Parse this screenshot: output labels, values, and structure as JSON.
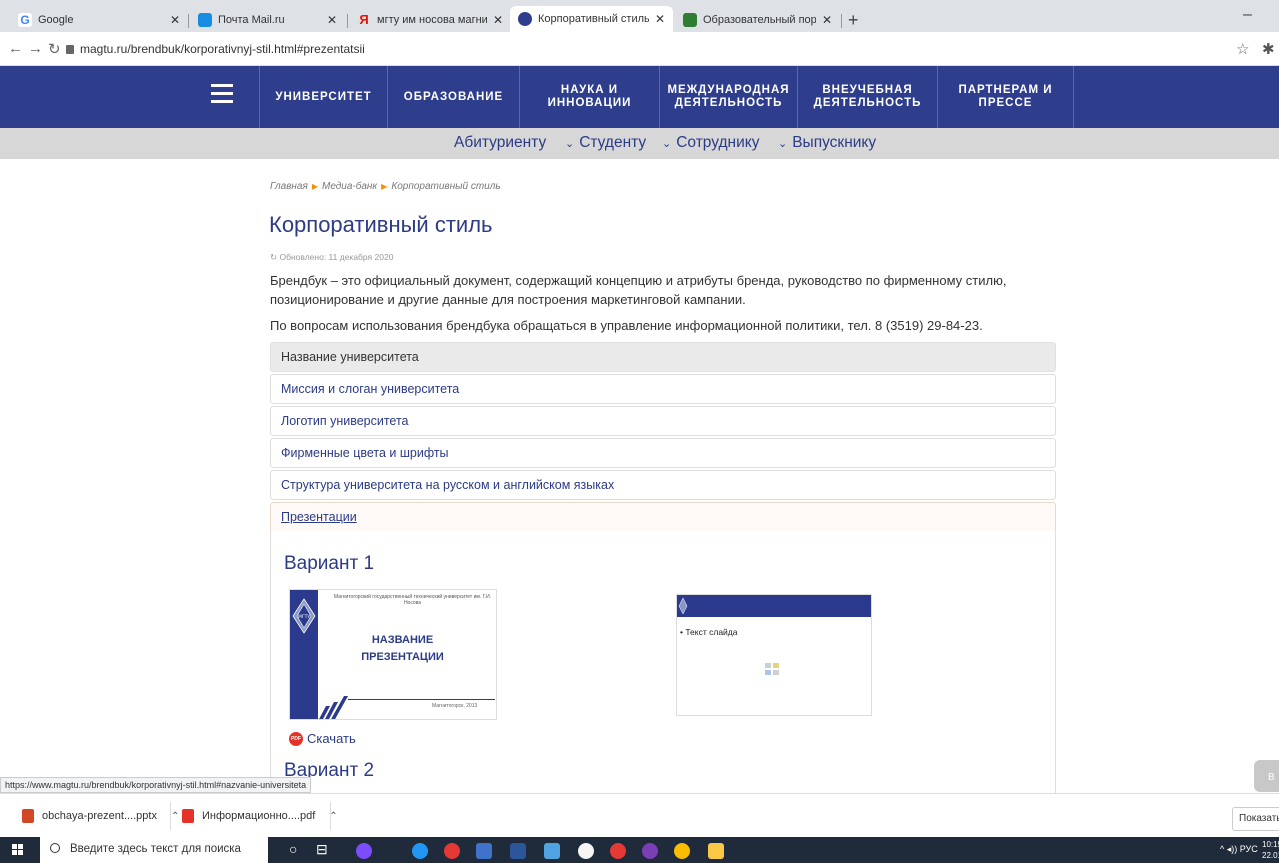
{
  "browser": {
    "tabs": [
      {
        "title": "Google",
        "icon": "google-icon",
        "color": "#4285f4"
      },
      {
        "title": "Почта Mail.ru",
        "icon": "mail-icon",
        "color": "#168de2"
      },
      {
        "title": "мгту им носова магнитогорск о",
        "icon": "yandex-icon",
        "color": "#e61400"
      },
      {
        "title": "Корпоративный стиль - ФГБОУ",
        "icon": "magtu-icon",
        "color": "#2e3e8c"
      },
      {
        "title": "Образовательный портал ФГБС",
        "icon": "portal-icon",
        "color": "#2e7d32"
      }
    ],
    "new_tab": "+",
    "minimize": "–",
    "url": "magtu.ru/brendbuk/korporativnyj-stil.html#prezentatsii"
  },
  "topnav": {
    "items": [
      "УНИВЕРСИТЕТ",
      "ОБРАЗОВАНИЕ",
      "НАУКА И\nИННОВАЦИИ",
      "МЕЖДУНАРОДНАЯ\nДЕЯТЕЛЬНОСТЬ",
      "ВНЕУЧЕБНАЯ\nДЕЯТЕЛЬНОСТЬ",
      "ПАРТНЕРАМ И\nПРЕССЕ"
    ]
  },
  "subnav": {
    "items": [
      "Абитуриенту",
      "Студенту",
      "Сотруднику",
      "Выпускнику"
    ]
  },
  "breadcrumb": [
    "Главная",
    "Медиа-банк",
    "Корпоративный стиль"
  ],
  "page": {
    "title": "Корпоративный стиль",
    "updated": "Обновлено: 11 декабря 2020",
    "p1": "Брендбук – это официальный документ, содержащий концепцию и атрибуты бренда, руководство по фирменному стилю, позиционирование и другие данные для построения маркетинговой кампании.",
    "p2": "По вопросам использования брендбука обращаться в управление информационной политики, тел. 8 (3519) 29-84-23."
  },
  "accordion": [
    "Название университета",
    "Миссия и слоган университета",
    "Логотип университета",
    "Фирменные цвета и шрифты",
    "Структура университета на русском и английском языках",
    "Презентации"
  ],
  "presentations": {
    "variant1": "Вариант 1",
    "variant2": "Вариант 2",
    "slide1": {
      "institution": "Магнитогорский государственный технический университет им. Г.И. Носова",
      "name_line1": "НАЗВАНИЕ",
      "name_line2": "ПРЕЗЕНТАЦИИ",
      "city": "Магнитогорск, 2013",
      "logo_text": "МГТУ"
    },
    "slide2": {
      "bullet": "Текст слайда"
    },
    "download_label": "Скачать",
    "download_badge": "PDF"
  },
  "status_url": "https://www.magtu.ru/brendbuk/korporativnyj-stil.html#nazvanie-universiteta",
  "scroll_button": "В",
  "downloads": {
    "items": [
      {
        "name": "obchaya-prezent....pptx",
        "color": "#d24726"
      },
      {
        "name": "Информационно....pdf",
        "color": "#e4322b"
      }
    ],
    "show_all": "Показать"
  },
  "taskbar": {
    "search_placeholder": "Введите здесь текст для поиска",
    "lang": "РУС",
    "time": "10:15",
    "date": "22.01.21"
  },
  "colors": {
    "brand": "#2e3e8c",
    "accent": "#f39200"
  }
}
